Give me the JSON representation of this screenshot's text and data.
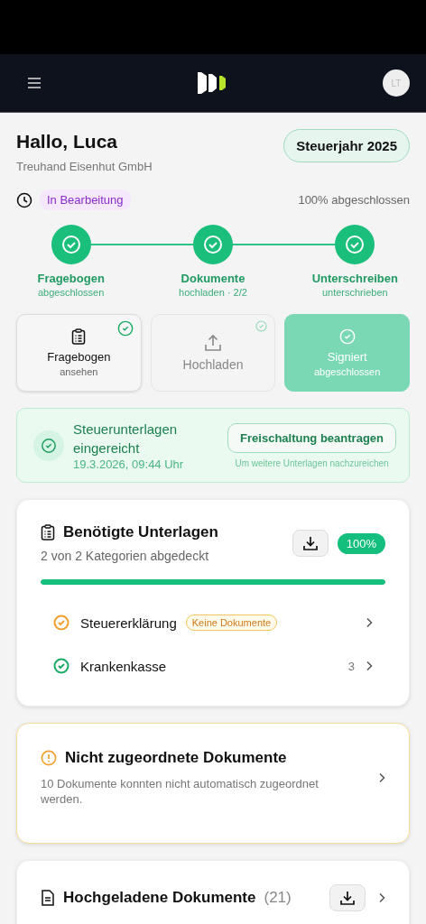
{
  "header": {
    "avatar": "LT"
  },
  "greeting": {
    "title": "Hallo, Luca",
    "company": "Treuhand Eisenhut GmbH",
    "tax_year": "Steuerjahr 2025"
  },
  "status": {
    "badge": "In Bearbeitung",
    "progress": "100% abgeschlossen"
  },
  "steps": [
    {
      "label": "Fragebogen",
      "sub": "abgeschlossen",
      "done": true
    },
    {
      "label": "Dokumente",
      "sub": "hochladen · 2/2",
      "done": true
    },
    {
      "label": "Unterschreiben",
      "sub": "unterschrieben",
      "done": true
    }
  ],
  "actions": [
    {
      "kind": "questionnaire",
      "label": "Fragebogen",
      "sub": "ansehen",
      "checked": true,
      "disabled": false
    },
    {
      "kind": "upload",
      "label": "Hochladen",
      "checked": true,
      "disabled": true
    },
    {
      "kind": "signed",
      "label": "Signiert",
      "sub": "abgeschlossen",
      "checked": true,
      "disabled": false
    }
  ],
  "submitted": {
    "title": "Steuerunterlagen eingereicht",
    "date": "19.3.2026, 09:44 Uhr",
    "button": "Freischaltung beantragen",
    "hint": "Um weitere Unterlagen nachzureichen"
  },
  "required": {
    "title": "Benötigte Unterlagen",
    "sub": "2 von 2 Kategorien abgedeckt",
    "percent": "100%",
    "level": 1,
    "categories": [
      {
        "name": "Steuererklärung",
        "color": "#f0a030",
        "badge": "Keine Dokumente"
      },
      {
        "name": "Krankenkasse",
        "color": "#1aaa66",
        "count": "3"
      }
    ]
  },
  "unassigned": {
    "title": "Nicht zugeordnete Dokumente",
    "text": "10 Dokumente konnten nicht automatisch zugeordnet werden."
  },
  "uploaded": {
    "title": "Hochgeladene Dokumente",
    "count": "(21)"
  }
}
